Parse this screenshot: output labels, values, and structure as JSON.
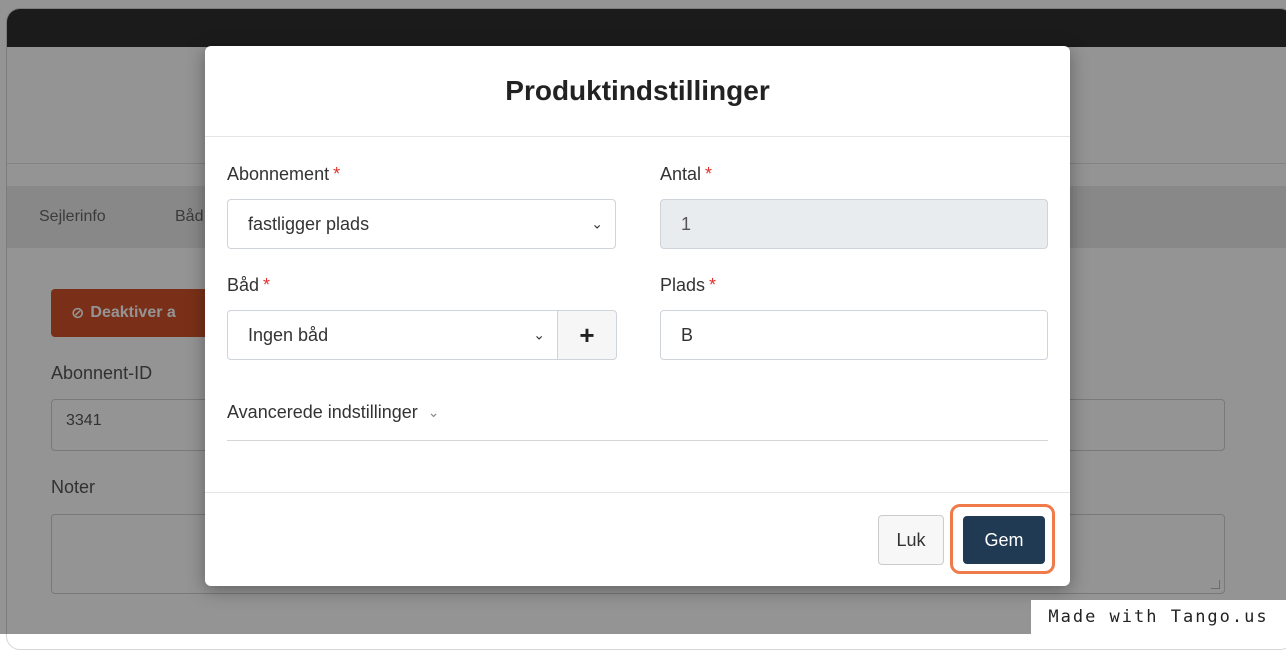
{
  "background": {
    "tabs": [
      "Sejlerinfo",
      "Båd"
    ],
    "deactivate_button": "Deaktiver a",
    "subscriber_id_label": "Abonnent-ID",
    "subscriber_id_value": "3341",
    "notes_label": "Noter"
  },
  "modal": {
    "title": "Produktindstillinger",
    "subscription": {
      "label": "Abonnement",
      "required_mark": "*",
      "value": "fastligger plads"
    },
    "quantity": {
      "label": "Antal",
      "required_mark": "*",
      "value": "1"
    },
    "boat": {
      "label": "Båd",
      "required_mark": "*",
      "value": "Ingen båd",
      "add_symbol": "+"
    },
    "place": {
      "label": "Plads",
      "required_mark": "*",
      "value": "B"
    },
    "advanced_label": "Avancerede indstillinger",
    "close_button": "Luk",
    "save_button": "Gem"
  },
  "watermark": "Made with Tango.us",
  "colors": {
    "primary_button": "#1f3a52",
    "highlight": "#f07b4a",
    "danger_button": "#d2542a",
    "required": "#e0322b"
  }
}
